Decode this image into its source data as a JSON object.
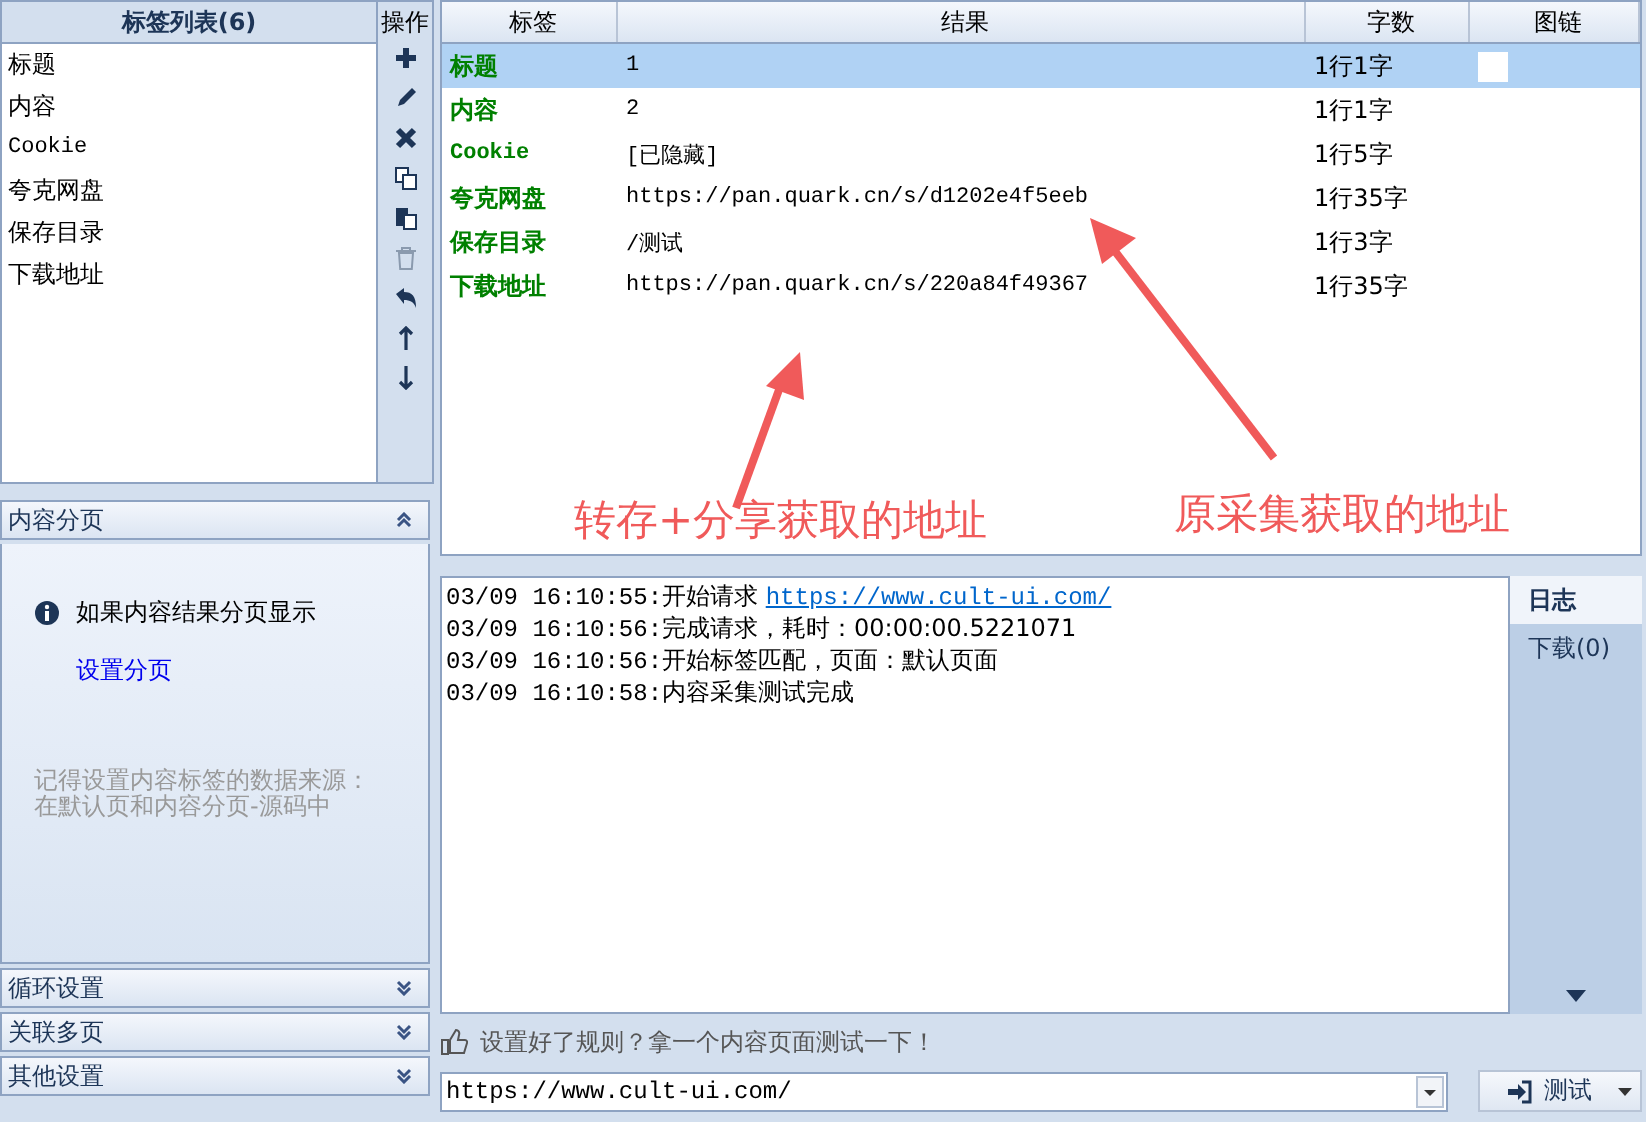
{
  "tag_list": {
    "title": "标签列表(6)",
    "items": [
      {
        "label": "标题",
        "selected": false
      },
      {
        "label": "内容",
        "selected": false
      },
      {
        "label": "Cookie",
        "selected": false
      },
      {
        "label": "夸克网盘",
        "selected": false
      },
      {
        "label": "保存目录",
        "selected": false
      },
      {
        "label": "下载地址",
        "selected": false
      }
    ]
  },
  "toolbar": {
    "title": "操作",
    "tools": [
      {
        "kind": "add"
      },
      {
        "kind": "edit"
      },
      {
        "kind": "delete"
      },
      {
        "kind": "copy"
      },
      {
        "kind": "paste"
      },
      {
        "kind": "trash"
      },
      {
        "kind": "undo"
      },
      {
        "kind": "up"
      },
      {
        "kind": "down"
      }
    ]
  },
  "table": {
    "columns": [
      "标签",
      "结果",
      "字数",
      "图链"
    ],
    "rows": [
      {
        "tag": "标题",
        "result": "1",
        "count": "1行1字",
        "selected": true
      },
      {
        "tag": "内容",
        "result": "2",
        "count": "1行1字",
        "selected": false
      },
      {
        "tag": "Cookie",
        "result": "[已隐藏]",
        "count": "1行5字",
        "selected": false
      },
      {
        "tag": "夸克网盘",
        "result": "https://pan.quark.cn/s/d1202e4f5eeb",
        "count": "1行35字",
        "selected": false
      },
      {
        "tag": "保存目录",
        "result": "/测试",
        "count": "1行3字",
        "selected": false
      },
      {
        "tag": "下载地址",
        "result": "https://pan.quark.cn/s/220a84f49367",
        "count": "1行35字",
        "selected": false
      }
    ]
  },
  "annotations": [
    {
      "text": "转存+分享获取的地址"
    },
    {
      "text": "原采集获取的地址"
    }
  ],
  "accordion": [
    {
      "title": "内容分页",
      "expanded": true,
      "info": "如果内容结果分页显示",
      "link": "设置分页",
      "note": [
        "记得设置内容标签的数据来源：",
        "在默认页和内容分页-源码中"
      ]
    },
    {
      "title": "循环设置",
      "expanded": false
    },
    {
      "title": "关联多页",
      "expanded": false
    },
    {
      "title": "其他设置",
      "expanded": false
    }
  ],
  "log": {
    "lines": [
      {
        "time": "03/09 16:10:55:",
        "text": "开始请求 ",
        "link": "https://www.cult-ui.com/"
      },
      {
        "time": "03/09 16:10:56:",
        "text": "完成请求，耗时：00:00:00.5221071"
      },
      {
        "time": "03/09 16:10:56:",
        "text": "开始标签匹配，页面：默认页面"
      },
      {
        "time": "03/09 16:10:58:",
        "text": "内容采集测试完成"
      }
    ],
    "tabs": [
      {
        "label": "日志",
        "selected": true
      },
      {
        "label": "下载(0)",
        "selected": false
      }
    ]
  },
  "hint": "设置好了规则？拿一个内容页面测试一下！",
  "url_field": {
    "value": "https://www.cult-ui.com/"
  },
  "test_button": "测试"
}
